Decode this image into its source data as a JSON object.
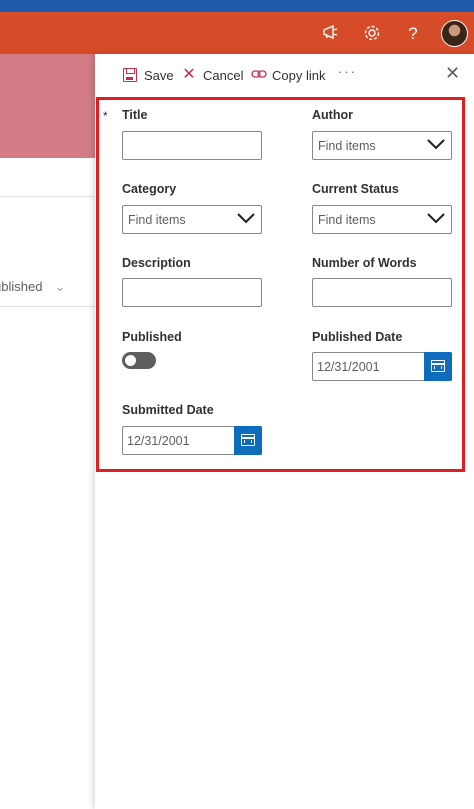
{
  "suitebar": {
    "icons": [
      "megaphone-icon",
      "gear-icon",
      "help-icon"
    ]
  },
  "background": {
    "column_header": "ublished"
  },
  "commands": {
    "save_label": "Save",
    "cancel_label": "Cancel",
    "copy_link_label": "Copy link",
    "more_label": "···",
    "close_label": "✕"
  },
  "form": {
    "required_marker": "*",
    "title_label": "Title",
    "title_value": "",
    "author_label": "Author",
    "author_placeholder": "Find items",
    "category_label": "Category",
    "category_placeholder": "Find items",
    "current_status_label": "Current Status",
    "current_status_placeholder": "Find items",
    "description_label": "Description",
    "description_value": "",
    "number_of_words_label": "Number of Words",
    "number_of_words_value": "",
    "published_label": "Published",
    "published_on": false,
    "published_date_label": "Published Date",
    "published_date_value": "12/31/2001",
    "submitted_date_label": "Submitted Date",
    "submitted_date_value": "12/31/2001"
  },
  "colors": {
    "suitebar": "#d64b28",
    "top_strip": "#1e5aa8",
    "accent_blue": "#0f6cbd",
    "highlight_border": "#e01e22",
    "command_icon": "#c4314b"
  }
}
